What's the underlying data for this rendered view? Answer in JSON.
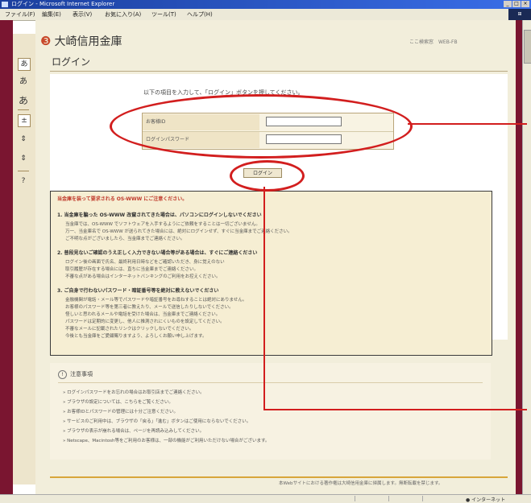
{
  "window": {
    "title": "ログイン - Microsoft Internet Explorer",
    "controls": [
      "_",
      "□",
      "×"
    ]
  },
  "menubar": {
    "items": [
      "ファイル(F)",
      "編集(E)",
      "表示(V)",
      "お気に入り(A)",
      "ツール(T)",
      "ヘルプ(H)"
    ]
  },
  "brand": {
    "name": "大崎信用金庫",
    "top_links": "ここ検索窓　WEB-FB"
  },
  "page": {
    "title": "ログイン",
    "instruction": "以下の項目を入力して、「ログイン」ボタンを押してください。"
  },
  "sidebar_tools": [
    "あ",
    "あ",
    "あ",
    "±",
    "⇕",
    "?"
  ],
  "form": {
    "fields": [
      {
        "label": "お客様ID",
        "value": ""
      },
      {
        "label": "ログインパスワード",
        "value": ""
      }
    ],
    "login_button": "ログイン"
  },
  "notice": {
    "heading": "当金庫を装って要求される OS-WWW にご注意ください。",
    "sections": [
      {
        "title": "1. 当金庫を騙った OS-WWW 改竄されてきた場合は、パソコンにログインしないでください",
        "lines": [
          "当金庫では、OS-WWW でソフトウェアを入手するようにご依頼をすることは一切ございません。",
          "万一、当金庫名で OS-WWW が送られてきた場合には、絶対にログインせず、すぐに当金庫までご連絡ください。",
          "ご不明な点がございましたら、当金庫までご連絡ください。"
        ]
      },
      {
        "title": "2. 普段見ないご確認のうえ正しく入力できない場合等がある場合は、すぐにご連絡ください",
        "lines": [
          "ログイン後の画面で氏名、最終利用日時などをご確認いただき、身に覚えのない",
          "取引履歴が存在する場合には、直ちに当金庫までご連絡ください。",
          "不審な点がある場合はインターネットバンキングのご利用をお控えください。"
        ]
      },
      {
        "title": "3. ご自身で行わないパスワード・暗証番号等を絶対に教えないでください",
        "lines": [
          "金融機関が電話・メール等でパスワードや暗証番号をお尋ねすることは絶対にありません。",
          "お客様のパスワード等を第三者に教えたり、メールで送信したりしないでください。",
          "怪しいと思われるメールや電話を受けた場合は、当金庫までご連絡ください。",
          "パスワードは定期的に変更し、他人に推測されにくいものを設定してください。",
          "不審なメールに記載されたリンクはクリックしないでください。",
          "今後とも当金庫をご愛顧賜りますよう、よろしくお願い申し上げます。"
        ]
      }
    ]
  },
  "notes": {
    "heading": "注意事項",
    "items": [
      "ログインパスワードをお忘れの場合はお取引店までご連絡ください。",
      "ブラウザの設定については、こちらをご覧ください。",
      "お客様IDとパスワードの管理には十分ご注意ください。",
      "サービスのご利用中は、ブラウザの「戻る」「進む」ボタンはご使用にならないでください。",
      "ブラウザの表示が崩れる場合は、ページを再読み込みしてください。",
      "Netscape、Macintosh等をご利用のお客様は、一部の機能がご利用いただけない場合がございます。"
    ]
  },
  "footer": {
    "text": "本Webサイトにおける著作権は大崎信用金庫に帰属します。無断転載を禁じます。"
  },
  "statusbar": {
    "zone": "インターネット"
  },
  "colors": {
    "annotation_red": "#d21e1e",
    "frame_maroon": "#7a1530",
    "accent_gold": "#d8a63a"
  }
}
